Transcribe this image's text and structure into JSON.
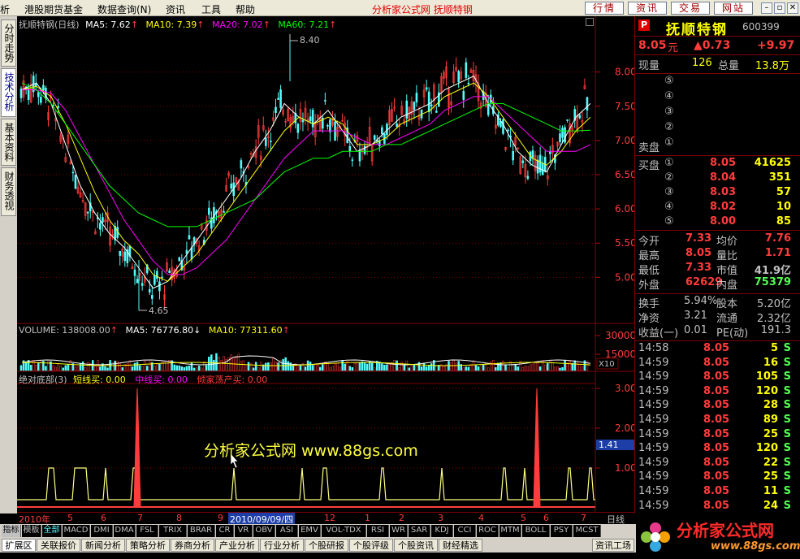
{
  "menu": {
    "items": [
      "析",
      "港股期货基金",
      "数据查询(N)",
      "资讯",
      "工具",
      "帮助"
    ],
    "title": "分析家公式网  抚顺特钢",
    "buttons": [
      "行情",
      "资讯",
      "交易",
      "网站"
    ]
  },
  "left_tabs": [
    "分时走势",
    "技术分析",
    "基本资料",
    "财务透视"
  ],
  "chart": {
    "price_header": {
      "name": "抚顺特钢(日线)",
      "ma5": "MA5: 7.62",
      "ma10": "MA10: 7.39",
      "ma20": "MA20: 7.02",
      "ma60": "MA60: 7.21"
    },
    "price_labels": {
      "high": "8.40",
      "low": "4.65"
    },
    "price_ticks": [
      "8.00",
      "7.50",
      "7.00",
      "6.50",
      "6.00",
      "5.50",
      "5.00"
    ],
    "volume_header": {
      "vol": "VOLUME: 138008.00",
      "ma5": "MA5: 76776.80",
      "ma10": "MA10: 77311.60"
    },
    "volume_ticks": [
      "30000",
      "15000"
    ],
    "volume_unit": "X10",
    "indicator_header": {
      "name": "绝对底部(3)",
      "short": "短线买: 0.00",
      "mid": "中线买: 0.00",
      "big": "倾家荡产买: 0.00"
    },
    "indicator_ticks": [
      "3.00",
      "2.00",
      "1.00"
    ],
    "indicator_marker": "1.41",
    "watermark": "分析家公式网 www.88gs.com",
    "dates": [
      "2010年",
      "5",
      "6",
      "7",
      "8",
      "9",
      "2010/09/09/四",
      "12",
      "1",
      "2",
      "3",
      "4",
      "5",
      "6",
      "7"
    ],
    "period": "日线",
    "colors": {
      "up": "#ff3c3c",
      "down": "#54fcfc",
      "ma5": "#ffffff",
      "ma10": "#ffff00",
      "ma20": "#ff00ff",
      "ma60": "#00ff00"
    }
  },
  "chart_data": {
    "type": "line",
    "title": "抚顺特钢(日线)",
    "ylim": [
      4.5,
      8.6
    ],
    "series": [
      {
        "name": "MA5",
        "values": [
          7.8,
          7.9,
          7.6,
          7.0,
          6.4,
          6.0,
          5.7,
          5.5,
          5.2,
          4.9,
          5.0,
          5.3,
          5.6,
          5.9,
          6.2,
          6.5,
          6.9,
          7.2,
          7.6,
          7.4,
          7.3,
          7.5,
          7.2,
          6.9,
          7.0,
          7.2,
          7.4,
          7.5,
          7.6,
          7.8,
          7.9,
          8.0,
          7.6,
          7.3,
          6.9,
          6.7,
          6.6,
          7.0,
          7.4,
          7.6
        ]
      },
      {
        "name": "MA10",
        "values": [
          7.8,
          7.85,
          7.7,
          7.3,
          6.8,
          6.3,
          5.9,
          5.6,
          5.4,
          5.1,
          5.0,
          5.2,
          5.4,
          5.7,
          6.0,
          6.3,
          6.6,
          6.9,
          7.2,
          7.4,
          7.3,
          7.4,
          7.3,
          7.0,
          7.0,
          7.1,
          7.3,
          7.4,
          7.5,
          7.7,
          7.8,
          7.9,
          7.7,
          7.4,
          7.1,
          6.8,
          6.7,
          6.9,
          7.2,
          7.4
        ]
      },
      {
        "name": "MA20",
        "values": [
          7.8,
          7.8,
          7.75,
          7.5,
          7.1,
          6.7,
          6.3,
          5.9,
          5.6,
          5.3,
          5.1,
          5.1,
          5.2,
          5.4,
          5.6,
          5.9,
          6.2,
          6.5,
          6.8,
          7.0,
          7.2,
          7.2,
          7.2,
          7.1,
          7.0,
          7.0,
          7.1,
          7.2,
          7.3,
          7.5,
          7.6,
          7.7,
          7.7,
          7.5,
          7.3,
          7.1,
          6.9,
          6.9,
          6.9,
          7.0
        ]
      },
      {
        "name": "MA60",
        "values": [
          7.9,
          7.8,
          7.6,
          7.3,
          7.0,
          6.7,
          6.4,
          6.2,
          6.0,
          5.9,
          5.8,
          5.8,
          5.8,
          5.9,
          6.0,
          6.1,
          6.2,
          6.4,
          6.6,
          6.7,
          6.8,
          6.8,
          6.9,
          6.9,
          6.9,
          7.0,
          7.0,
          7.1,
          7.2,
          7.3,
          7.4,
          7.5,
          7.6,
          7.6,
          7.5,
          7.4,
          7.3,
          7.2,
          7.2,
          7.21
        ]
      }
    ]
  },
  "quote": {
    "stock_name": "抚顺特钢",
    "code": "600399",
    "price": "8.05",
    "price_unit": "元",
    "change": "▲0.73",
    "change_pct": "+9.97",
    "now_vol_label": "现量",
    "now_vol": "126",
    "total_vol_label": "总量",
    "total_vol": "13.8万",
    "sell_levels": [
      "⑤",
      "④",
      "③",
      "②",
      "①"
    ],
    "sell_label": "卖盘",
    "buy_label": "买盘",
    "buys": [
      {
        "n": "①",
        "price": "8.05",
        "vol": "41625"
      },
      {
        "n": "②",
        "price": "8.04",
        "vol": "351"
      },
      {
        "n": "③",
        "price": "8.03",
        "vol": "57"
      },
      {
        "n": "④",
        "price": "8.02",
        "vol": "10"
      },
      {
        "n": "⑤",
        "price": "8.00",
        "vol": "85"
      }
    ],
    "stats": [
      {
        "l1": "今开",
        "v1": "7.33",
        "l2": "均价",
        "v2": "7.76"
      },
      {
        "l1": "最高",
        "v1": "8.05",
        "l2": "量比",
        "v2": "1.71"
      },
      {
        "l1": "最低",
        "v1": "7.33",
        "l2": "市值",
        "v2": "41.9亿"
      },
      {
        "l1": "外盘",
        "v1": "62629",
        "l2": "内盘",
        "v2": "75379"
      }
    ],
    "stats2": [
      {
        "l1": "换手",
        "v1": "5.94%",
        "l2": "股本",
        "v2": "5.20亿"
      },
      {
        "l1": "净资",
        "v1": "3.21",
        "l2": "流通",
        "v2": "2.32亿"
      },
      {
        "l1": "收益(一)",
        "v1": "0.01",
        "l2": "PE(动)",
        "v2": "191.3"
      }
    ],
    "ticks": [
      {
        "t": "14:58",
        "p": "8.05",
        "v": "5",
        "s": "S"
      },
      {
        "t": "14:59",
        "p": "8.05",
        "v": "16",
        "s": "S"
      },
      {
        "t": "14:59",
        "p": "8.05",
        "v": "105",
        "s": "S"
      },
      {
        "t": "14:59",
        "p": "8.05",
        "v": "120",
        "s": "S"
      },
      {
        "t": "14:59",
        "p": "8.05",
        "v": "28",
        "s": "S"
      },
      {
        "t": "14:59",
        "p": "8.05",
        "v": "89",
        "s": "S"
      },
      {
        "t": "14:59",
        "p": "8.05",
        "v": "25",
        "s": "S"
      },
      {
        "t": "14:59",
        "p": "8.05",
        "v": "120",
        "s": "S"
      },
      {
        "t": "14:59",
        "p": "8.05",
        "v": "22",
        "s": "S"
      },
      {
        "t": "14:59",
        "p": "8.05",
        "v": "25",
        "s": "S"
      },
      {
        "t": "14:59",
        "p": "8.05",
        "v": "11",
        "s": "S"
      },
      {
        "t": "14:59",
        "p": "8.05",
        "v": "24",
        "s": "S"
      }
    ]
  },
  "indicator_tabs": [
    "指标",
    "模板",
    "全部",
    "MACD",
    "DMI",
    "DMA",
    "FSL",
    "TRIX",
    "BRAR",
    "CR",
    "VR",
    "OBV",
    "ASI",
    "EMV",
    "VOL-TDX",
    "RSI",
    "WR",
    "SAR",
    "KDJ",
    "CCI",
    "ROC",
    "MTM",
    "BOLL",
    "PSY",
    "MCST"
  ],
  "bottom_tabs": [
    "扩展区",
    "关联报价",
    "新闻分析",
    "策略分析",
    "券商分析",
    "产业分析",
    "行业分析",
    "个股研报",
    "个股评级",
    "个股资讯",
    "财经精选"
  ],
  "bottom_right_tab": "资讯工场",
  "logo": {
    "text": "分析家公式网",
    "url": "www.88gs.com"
  }
}
